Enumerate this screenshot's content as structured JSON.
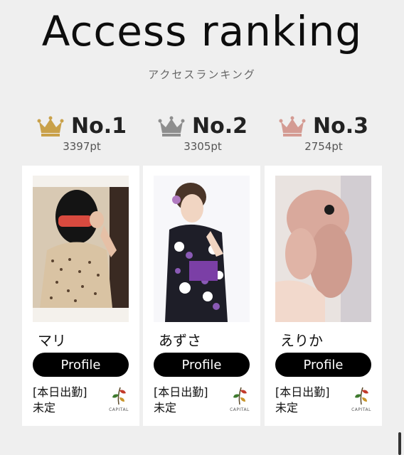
{
  "header": {
    "title": "Access ranking",
    "subtitle": "アクセスランキング"
  },
  "rankings": [
    {
      "rank_label": "No.1",
      "points": "3397pt",
      "crown_color": "#c9a14a",
      "name": "マリ",
      "profile_label": "Profile",
      "status_label": "[本日出勤]",
      "status_value": "未定",
      "logo_name": "capital-logo",
      "logo_text": "CAPITAL"
    },
    {
      "rank_label": "No.2",
      "points": "3305pt",
      "crown_color": "#8e8e8e",
      "name": "あずさ",
      "profile_label": "Profile",
      "status_label": "[本日出勤]",
      "status_value": "未定",
      "logo_name": "capital-logo",
      "logo_text": "CAPITAL"
    },
    {
      "rank_label": "No.3",
      "points": "2754pt",
      "crown_color": "#d49b93",
      "name": "えりか",
      "profile_label": "Profile",
      "status_label": "[本日出勤]",
      "status_value": "未定",
      "logo_name": "capital-logo",
      "logo_text": "CAPITAL"
    }
  ],
  "colors": {
    "background": "#efefef",
    "button": "#000000",
    "gold": "#c9a14a",
    "silver": "#8e8e8e",
    "bronze": "#d49b93"
  }
}
